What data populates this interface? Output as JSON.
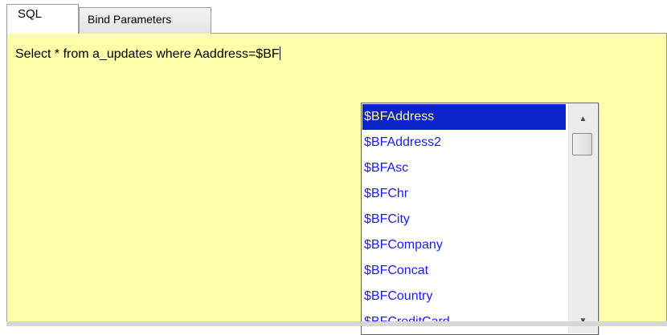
{
  "tabs": [
    {
      "label": "SQL",
      "active": true
    },
    {
      "label": "Bind Parameters",
      "active": false
    }
  ],
  "editor": {
    "text": "Select * from a_updates where Aaddress=$BF",
    "background": "#ffffaa"
  },
  "autocomplete": {
    "selected_index": 0,
    "items": [
      "$BFAddress",
      "$BFAddress2",
      "$BFAsc",
      "$BFChr",
      "$BFCity",
      "$BFCompany",
      "$BFConcat",
      "$BFCountry",
      "$BFCreditCard"
    ],
    "item_color": "#1a1aff",
    "selected_background": "#0a24c9",
    "selected_text_color": "#ffff7a"
  },
  "scrollbar": {
    "up_icon": "triangle-up",
    "down_icon": "triangle-down"
  }
}
